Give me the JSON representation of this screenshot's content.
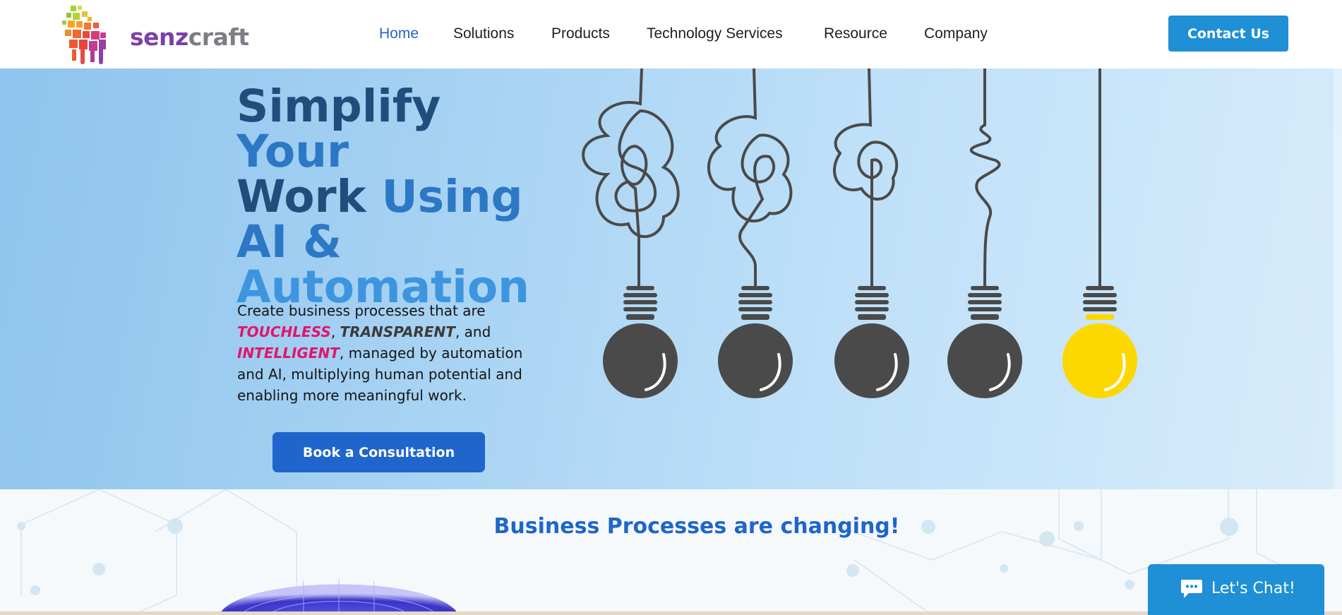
{
  "brand": {
    "name_part1": "senz",
    "name_part2": "craft"
  },
  "nav": {
    "items": [
      {
        "label": "Home",
        "active": true
      },
      {
        "label": "Solutions",
        "active": false
      },
      {
        "label": "Products",
        "active": false
      },
      {
        "label": "Technology Services",
        "active": false
      },
      {
        "label": "Resource",
        "active": false
      },
      {
        "label": "Company",
        "active": false
      }
    ],
    "contact_label": "Contact Us"
  },
  "hero": {
    "headline": {
      "w1": "Simplify",
      "w2": "Your",
      "w3": "Work",
      "w4": "Using",
      "w5": "AI &",
      "w6": "Automation"
    },
    "description": {
      "intro": "Create business processes that are",
      "k1": "TOUCHLESS",
      "sep1": ", ",
      "k2": "TRANSPARENT",
      "sep2": ", and ",
      "k3": "INTELLIGENT",
      "sep3": ",",
      "rest": "managed by automation and AI, multiplying human potential and enabling more meaningful work."
    },
    "cta_label": "Book a Consultation",
    "bulb_colors": [
      "#4a4a4a",
      "#4a4a4a",
      "#4a4a4a",
      "#4a4a4a",
      "#fcd800"
    ]
  },
  "section2": {
    "title": "Business Processes are changing!"
  },
  "chat": {
    "label": "Let's Chat!",
    "icon": "chat-bubble-icon"
  },
  "colors": {
    "primary_blue": "#1f65cc",
    "contact_blue": "#1f8fd6",
    "accent_pink": "#e3146c",
    "bulb_yellow": "#fcd800"
  }
}
